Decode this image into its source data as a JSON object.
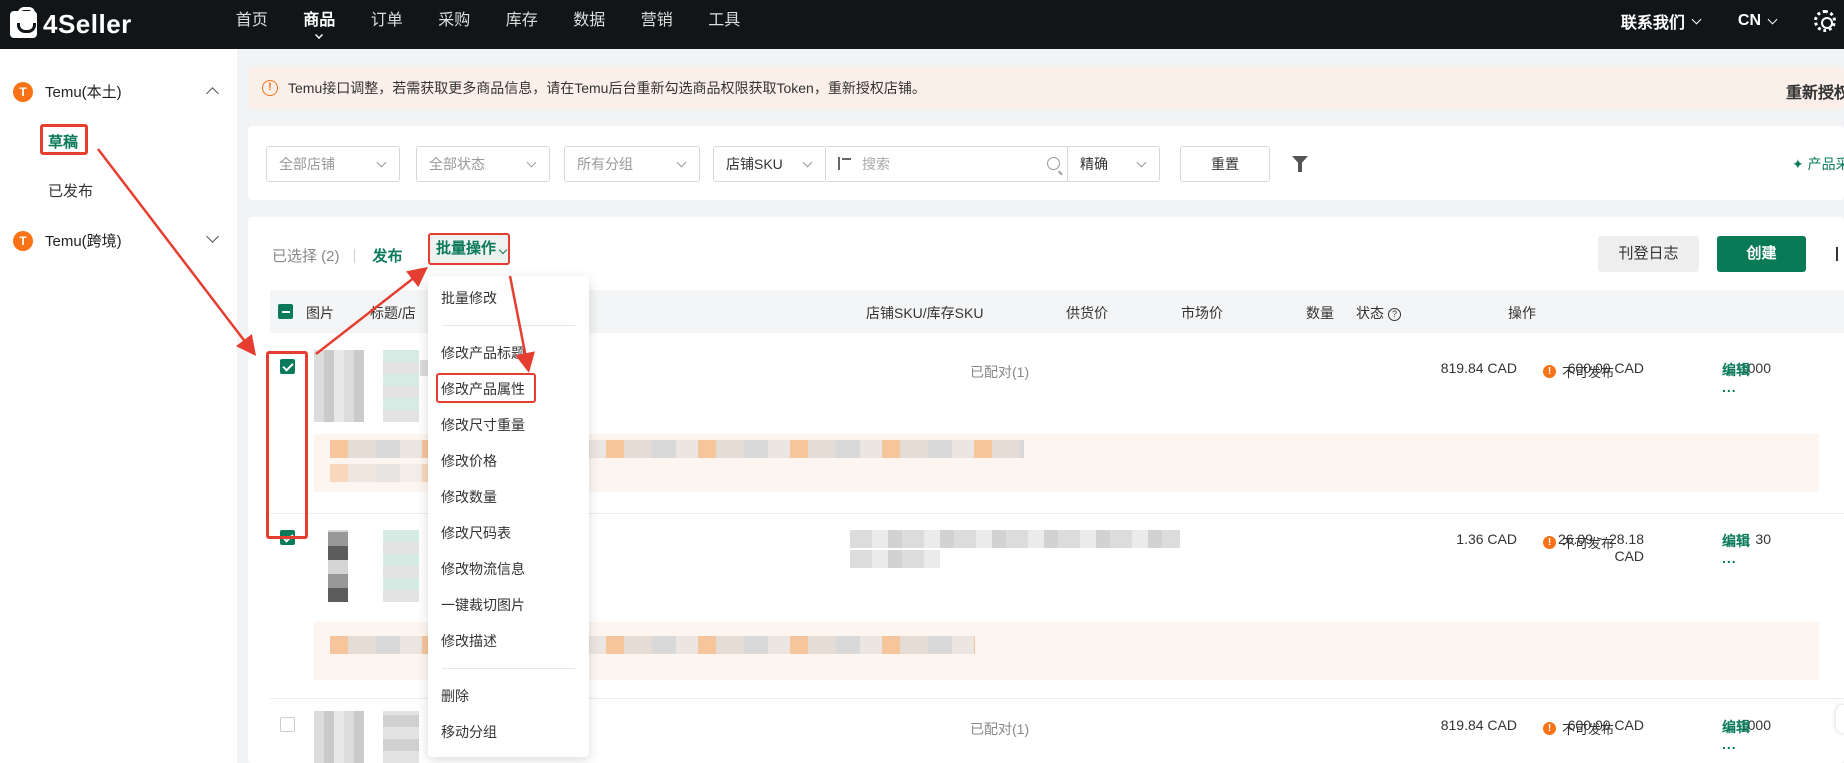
{
  "header": {
    "logo_text": "4Seller",
    "nav": [
      {
        "label": "首页",
        "active": false
      },
      {
        "label": "商品",
        "active": true
      },
      {
        "label": "订单",
        "active": false
      },
      {
        "label": "采购",
        "active": false
      },
      {
        "label": "库存",
        "active": false
      },
      {
        "label": "数据",
        "active": false
      },
      {
        "label": "营销",
        "active": false
      },
      {
        "label": "工具",
        "active": false
      }
    ],
    "contact_label": "联系我们",
    "lang_label": "CN"
  },
  "sidebar": {
    "groups": [
      {
        "badge": "T",
        "label": "Temu(本土)",
        "expanded": true
      },
      {
        "badge": "T",
        "label": "Temu(跨境)",
        "expanded": false
      }
    ],
    "items": [
      {
        "label": "草稿",
        "active": true
      },
      {
        "label": "已发布",
        "active": false
      }
    ]
  },
  "notice": {
    "icon": "!",
    "text": "Temu接口调整，若需获取更多商品信息，请在Temu后台重新勾选商品权限获取Token，重新授权店铺。",
    "action": "重新授权"
  },
  "filters": {
    "store": "全部店铺",
    "status": "全部状态",
    "group": "所有分组",
    "sku_type": "店铺SKU",
    "search_placeholder": "搜索",
    "match_mode": "精确",
    "reset_label": "重置",
    "ai_link": "✦ 产品采"
  },
  "toolbar": {
    "selected": "已选择 (2)",
    "publish": "发布",
    "batch": "批量操作",
    "log": "刊登日志",
    "create": "创建"
  },
  "table": {
    "headers": {
      "image": "图片",
      "title": "标题/店",
      "sku": "店铺SKU/库存SKU",
      "supply_price": "供货价",
      "market_price": "市场价",
      "quantity": "数量",
      "status": "状态",
      "status_help": "?",
      "actions": "操作"
    },
    "rows": [
      {
        "checked": true,
        "sku": "已配对(1)",
        "supply_price": "819.84 CAD",
        "market_price": "600.00 CAD",
        "quantity": "1000",
        "status": "不可发布",
        "edit": "编辑",
        "more": "..."
      },
      {
        "checked": true,
        "sku": "",
        "supply_price": "1.36 CAD",
        "market_price": "26.09 ~ 28.18",
        "market_price_unit": "CAD",
        "quantity": "30",
        "status": "不可发布",
        "edit": "编辑",
        "more": "..."
      },
      {
        "checked": false,
        "sku": "已配对(1)",
        "supply_price": "819.84 CAD",
        "market_price": "600.00 CAD",
        "quantity": "1000",
        "status": "不可发布",
        "edit": "编辑",
        "more": "..."
      }
    ]
  },
  "dropdown": {
    "items": [
      "批量修改",
      "修改产品标题",
      "修改产品属性",
      "修改尺寸重量",
      "修改价格",
      "修改数量",
      "修改尺码表",
      "修改物流信息",
      "一键裁切图片",
      "修改描述",
      "删除",
      "移动分组"
    ],
    "highlighted": "修改产品属性"
  },
  "colors": {
    "brand_green": "#087a55",
    "annotation_red": "#e53e30",
    "warning_orange": "#f97316",
    "topbar": "#111517"
  }
}
